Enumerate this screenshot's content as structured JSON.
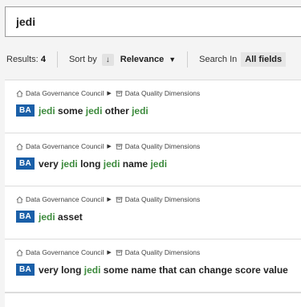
{
  "search": {
    "value": "jedi",
    "placeholder": ""
  },
  "toolbar": {
    "results_label": "Results:",
    "results_count": "4",
    "sort_label": "Sort by",
    "sort_direction": "↓",
    "sort_value": "Relevance",
    "sort_caret": "▼",
    "search_in_label": "Search In",
    "search_in_value": "All fields"
  },
  "colors": {
    "badge": "#1a5fa8",
    "highlight": "#3d8b3d"
  },
  "results": [
    {
      "breadcrumb": [
        "Data Governance Council",
        "Data Quality Dimensions"
      ],
      "badge": "BA",
      "title_parts": [
        {
          "text": "jedi",
          "hl": true
        },
        {
          "text": " some ",
          "hl": false
        },
        {
          "text": "jedi",
          "hl": true
        },
        {
          "text": " other ",
          "hl": false
        },
        {
          "text": "jedi",
          "hl": true
        }
      ]
    },
    {
      "breadcrumb": [
        "Data Governance Council",
        "Data Quality Dimensions"
      ],
      "badge": "BA",
      "title_parts": [
        {
          "text": "very ",
          "hl": false
        },
        {
          "text": "jedi",
          "hl": true
        },
        {
          "text": " long ",
          "hl": false
        },
        {
          "text": "jedi",
          "hl": true
        },
        {
          "text": " name ",
          "hl": false
        },
        {
          "text": "jedi",
          "hl": true
        }
      ]
    },
    {
      "breadcrumb": [
        "Data Governance Council",
        "Data Quality Dimensions"
      ],
      "badge": "BA",
      "title_parts": [
        {
          "text": "jedi",
          "hl": true
        },
        {
          "text": " asset",
          "hl": false
        }
      ]
    },
    {
      "breadcrumb": [
        "Data Governance Council",
        "Data Quality Dimensions"
      ],
      "badge": "BA",
      "title_parts": [
        {
          "text": "very long ",
          "hl": false
        },
        {
          "text": "jedi",
          "hl": true
        },
        {
          "text": " some name that can change score value",
          "hl": false
        }
      ]
    }
  ]
}
